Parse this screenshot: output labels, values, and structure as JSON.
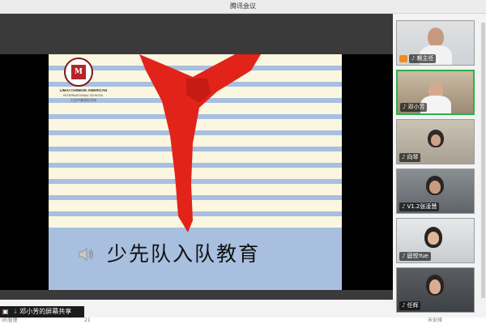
{
  "window": {
    "title": "腾讯会议"
  },
  "slide": {
    "title": "少先队入队教育",
    "logo": {
      "english_line1": "LIMAI CHINESE AMERICAN",
      "english_line2": "INTERNATIONAL SCHOOL",
      "chinese_name": "力迈中美国际学校"
    },
    "colors": {
      "scarf": "#e2231a",
      "stripe_blue": "#a7bfe0",
      "stripe_cream": "#fbf6df"
    }
  },
  "share_status": {
    "text": "邓小芳的屏幕共享"
  },
  "participants": [
    {
      "name": "赖主任",
      "active": false
    },
    {
      "name": "邓小芳",
      "active": true
    },
    {
      "name": "向琴",
      "active": false
    },
    {
      "name": "V1.2张凌慧",
      "active": false
    },
    {
      "name": "庭悦Yue",
      "active": false
    },
    {
      "name": "任辉",
      "active": false
    }
  ],
  "footer": {
    "left": "i的管理",
    "mid": "21",
    "right": "未安排"
  }
}
